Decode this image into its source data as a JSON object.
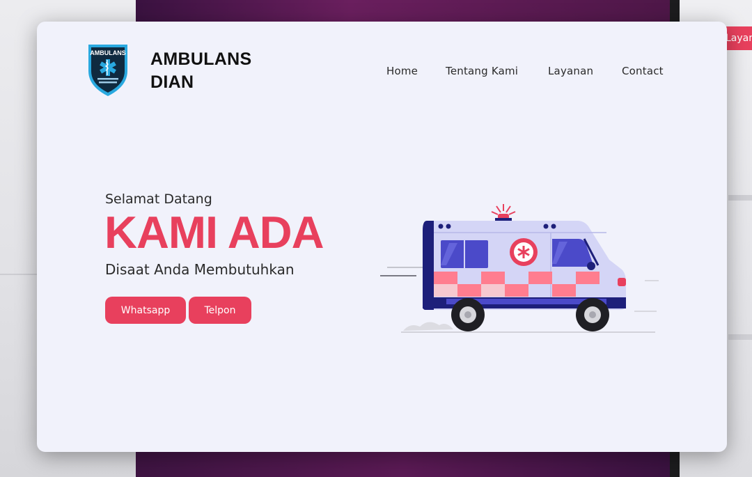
{
  "brand": {
    "line1": "AMBULANS",
    "line2": "DIAN",
    "logo_text": "AMBULANS"
  },
  "nav": {
    "items": [
      {
        "label": "Home"
      },
      {
        "label": "Tentang Kami"
      },
      {
        "label": "Layanan"
      },
      {
        "label": "Contact"
      }
    ]
  },
  "hero": {
    "welcome": "Selamat Datang",
    "headline": "KAMI ADA",
    "subheadline": "Disaat Anda Membutuhkan",
    "buttons": {
      "whatsapp": "Whatsapp",
      "telpon": "Telpon"
    }
  },
  "background": {
    "partial_button_text": "Layanan"
  },
  "colors": {
    "accent": "#e8405d",
    "card_background": "#f1f2fb",
    "text_dark": "#111111"
  },
  "icons": {
    "logo": "star-of-life-shield-icon",
    "illustration": "ambulance-illustration"
  }
}
